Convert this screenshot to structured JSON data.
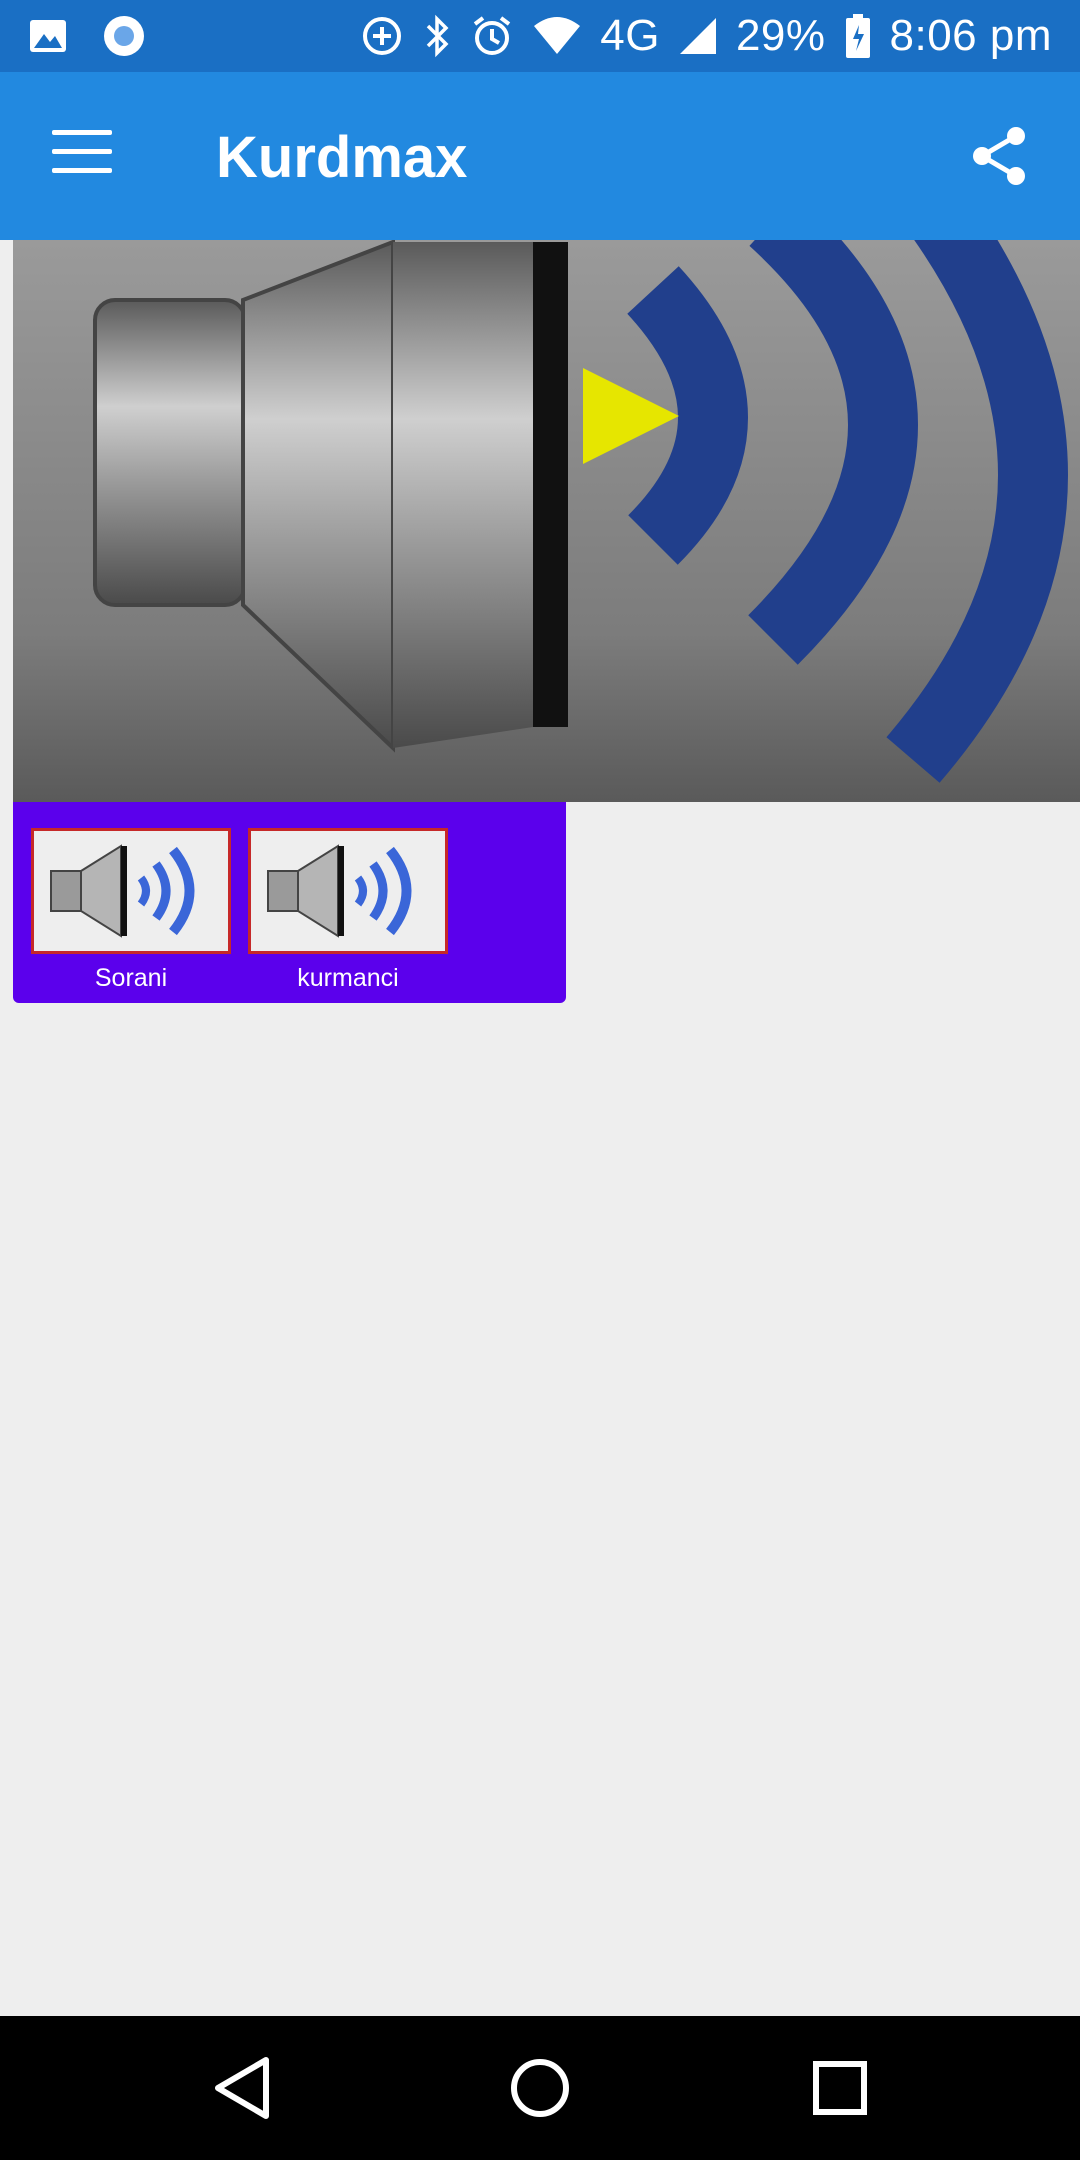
{
  "status_bar": {
    "network": "4G",
    "battery": "29%",
    "time": "8:06 pm",
    "icons": [
      "image-icon",
      "circle-icon",
      "data-saver-icon",
      "bluetooth-icon",
      "alarm-icon",
      "wifi-icon",
      "signal-icon",
      "battery-icon"
    ]
  },
  "app_bar": {
    "title": "Kurdmax",
    "menu_icon": "hamburger-menu-icon",
    "share_icon": "share-icon"
  },
  "colors": {
    "status_bar": "#1a6fc4",
    "app_bar": "#2289e0",
    "panel": "#5b00ec",
    "play": "#e6e600",
    "background": "#eeeeee"
  },
  "stations": [
    {
      "label": "Sorani",
      "icon": "speaker-icon"
    },
    {
      "label": "kurmanci",
      "icon": "speaker-icon"
    }
  ],
  "nav": {
    "back": "back-icon",
    "home": "home-icon",
    "recents": "recents-icon"
  }
}
